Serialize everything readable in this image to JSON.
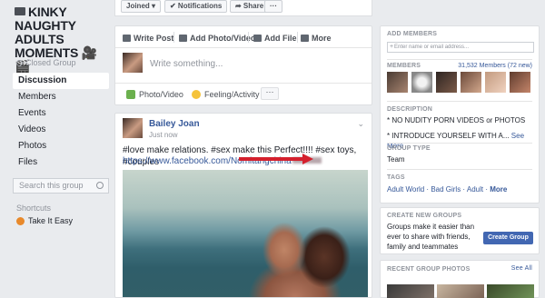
{
  "group": {
    "title": "KINKY NAUGHTY ADULTS MOMENTS 🎥🎬",
    "privacy": "Closed Group"
  },
  "nav": {
    "items": [
      {
        "label": "Discussion",
        "active": true
      },
      {
        "label": "Members"
      },
      {
        "label": "Events"
      },
      {
        "label": "Videos"
      },
      {
        "label": "Photos"
      },
      {
        "label": "Files"
      }
    ],
    "search_placeholder": "Search this group",
    "shortcuts_label": "Shortcuts",
    "shortcut_item": "Take It Easy"
  },
  "actions": {
    "joined": "Joined ▾",
    "notifications": "✔ Notifications",
    "share": "➦ Share",
    "more": "···"
  },
  "composer": {
    "write_post": "Write Post",
    "add_photo_video": "Add Photo/Video",
    "add_file": "Add File",
    "more": "More",
    "placeholder": "Write something...",
    "photo_video": "Photo/Video",
    "feeling_activity": "Feeling/Activity",
    "dots": "···"
  },
  "post": {
    "author": "Bailey Joan",
    "time": "Just now",
    "text": "#love make relations. #sex make this Perfect!!!! #sex toys, #couples",
    "link": "https://www.facebook.com/Nomitangchina"
  },
  "sidebar": {
    "add_members_title": "ADD MEMBERS",
    "add_members_placeholder": "Enter name or email address...",
    "members_title": "MEMBERS",
    "members_count": "31,532 Members (72 new)",
    "description_title": "DESCRIPTION",
    "description_line1": "* NO NUDITY PORN VIDEOS or PHOTOS",
    "description_line2": "* INTRODUCE YOURSELF WITH A...",
    "see_more": "See More",
    "group_type_title": "GROUP TYPE",
    "group_type": "Team",
    "tags_title": "TAGS",
    "tags": "Adult World · Bad Girls · Adult ·",
    "tags_more": "More",
    "create_title": "CREATE NEW GROUPS",
    "create_text": "Groups make it easier than ever to share with friends, family and teammates",
    "create_button": "Create Group",
    "recent_photos_title": "RECENT GROUP PHOTOS",
    "see_all": "See All"
  },
  "colors": {
    "link": "#365899",
    "primary_button": "#4267b2",
    "arrow": "#d4202d",
    "page_bg": "#e9ebee"
  }
}
